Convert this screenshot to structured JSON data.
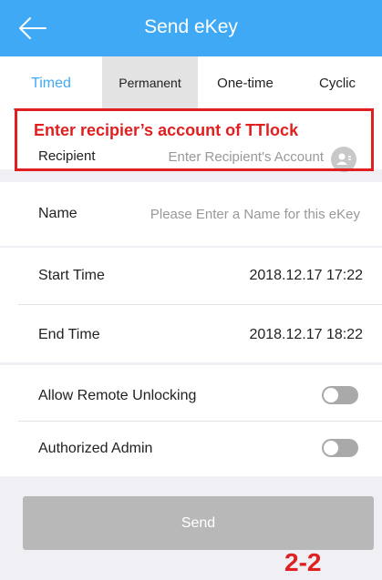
{
  "header": {
    "title": "Send eKey"
  },
  "tabs": [
    {
      "label": "Timed"
    },
    {
      "label": "Permanent"
    },
    {
      "label": "One-time"
    },
    {
      "label": "Cyclic"
    }
  ],
  "annotation": {
    "callout": "Enter recipier’s account of TTlock",
    "page_marker": "2-2"
  },
  "form": {
    "recipient": {
      "label": "Recipient",
      "placeholder": "Enter Recipient's Account",
      "value": ""
    },
    "name": {
      "label": "Name",
      "placeholder": "Please Enter a Name for this eKey",
      "value": ""
    },
    "start_time": {
      "label": "Start Time",
      "value": "2018.12.17 17:22"
    },
    "end_time": {
      "label": "End Time",
      "value": "2018.12.17 18:22"
    },
    "allow_remote_unlocking": {
      "label": "Allow Remote Unlocking",
      "enabled": false
    },
    "authorized_admin": {
      "label": "Authorized Admin",
      "enabled": false
    }
  },
  "send_button": {
    "label": "Send"
  },
  "colors": {
    "accent": "#3fa9f5",
    "annotation": "#e02020",
    "disabled_button": "#b8b8b8"
  },
  "icons": {
    "back": "back-arrow-icon",
    "contact": "contact-icon"
  }
}
